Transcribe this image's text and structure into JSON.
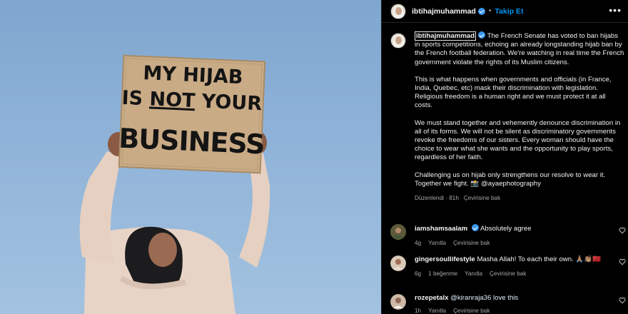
{
  "photo": {
    "sign_line1": "MY HIJAB",
    "sign_line2_prefix": "IS ",
    "sign_line2_not": "NOT",
    "sign_line2_suffix": " YOUR",
    "sign_line3": "BUSINESS"
  },
  "header": {
    "username": "ibtihajmuhammad",
    "separator": "•",
    "follow_label": "Takip Et",
    "more_label": "•••"
  },
  "caption": {
    "username": "ibtihajmuhammad",
    "paragraphs": [
      "The French Senate has voted to ban hijabs in sports competitions, echoing an already longstanding hijab ban by the French football federation. We're watching in real time the French government violate the rights of its Muslim citizens.",
      "This is what happens when governments and officials (in France, India, Quebec, etc) mask their discrimination with legislation. Religious freedom is a human right and we must protect it at all costs.",
      "We must stand together and vehemently denounce discrimination in all of its forms. We will not be silent as discriminatory governments revoke the freedoms of our sisters. Every woman should have the choice to wear what she wants and the opportunity to play sports, regardless of her faith.",
      "Challenging us on hijab only strengthens our resolve to wear it. Together we fight. 📸 @ayaephotography"
    ],
    "edited_label": "Düzenlendi",
    "time": "81h",
    "translate_label": "Çevirisine bak"
  },
  "comments": [
    {
      "username": "iamshamsaalam",
      "verified": true,
      "text": "Absolutely agree",
      "time": "4g",
      "likes": "",
      "reply_label": "Yanıtla",
      "translate_label": "Çevirisine bak"
    },
    {
      "username": "gingersoullifestyle",
      "verified": false,
      "text": "Masha Allah! To each their own. 🙏🏽👏🏽🇲🇦",
      "time": "6g",
      "likes": "1 beğenme",
      "reply_label": "Yanıtla",
      "translate_label": "Çevirisine bak"
    },
    {
      "username": "rozepetalx",
      "verified": false,
      "text": "@kiranraja36 love this",
      "time": "1h",
      "likes": "",
      "reply_label": "Yanıtla",
      "translate_label": "Çevirisine bak"
    }
  ],
  "colors": {
    "accent": "#0095f6",
    "verified": "#3897f0",
    "background": "#000000",
    "muted_text": "#a8a8a8"
  },
  "icons": {
    "more": "more-horizontal-icon",
    "verified": "verified-badge-icon",
    "like": "heart-outline-icon"
  }
}
